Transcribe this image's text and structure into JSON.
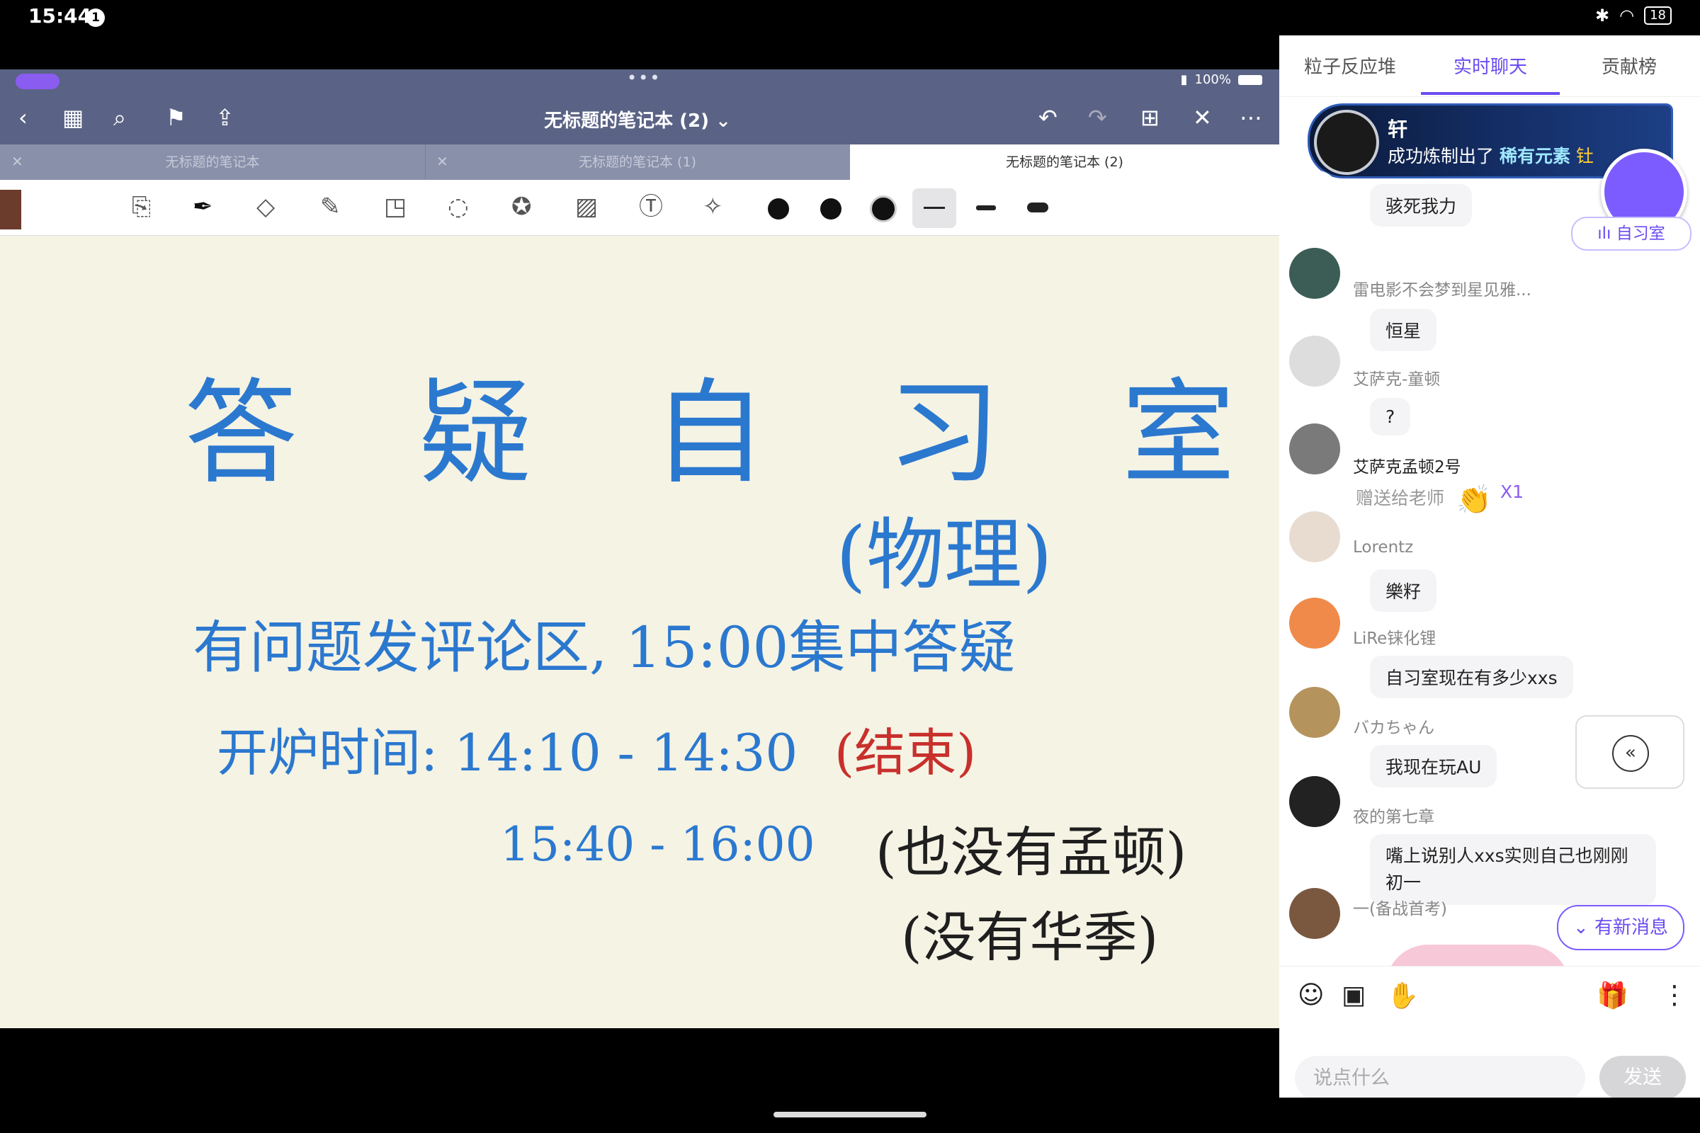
{
  "status": {
    "time": "15:44",
    "notif": "1",
    "battery": "18"
  },
  "notes_app": {
    "ipad_battery": "100%",
    "title": "无标题的笔记本 (2) ⌄",
    "tabs": [
      "无标题的笔记本",
      "无标题的笔记本 (1)",
      "无标题的笔记本 (2)"
    ],
    "handwriting": {
      "heading": "答 疑 自 习 室",
      "subheading": "(物理)",
      "line1": "有问题发评论区, 15:00集中答疑",
      "line2a": "开炉时间: 14:10 - 14:30",
      "line2b": "(结束)",
      "line3a": "15:40 - 16:00",
      "line3b": "(也没有孟顿)",
      "line4": "(没有华季)"
    },
    "colors": {
      "ink_blue": "#2b78cf",
      "ink_red": "#c8302c"
    }
  },
  "chat": {
    "tabs": [
      "粒子反应堆",
      "实时聊天",
      "贡献榜"
    ],
    "banner": {
      "name": "轩",
      "msg_prefix": "成功炼制出了",
      "msg_item": "稀有元素",
      "msg_tail": "钍"
    },
    "study_room_label": "ılı 自习室",
    "messages": [
      {
        "user": "",
        "text": "骇死我力"
      },
      {
        "user": "雷电影不会梦到星见雅...",
        "text": "恒星"
      },
      {
        "user": "艾萨克-童顿",
        "text": "?"
      },
      {
        "user": "艾萨克孟顿2号",
        "gift_text": "赠送给老师",
        "gift_count": "X1"
      },
      {
        "user": "Lorentz",
        "text": "樂籽"
      },
      {
        "user": "LiRe铼化锂",
        "text": "自习室现在有多少xxs"
      },
      {
        "user": "バカちゃん",
        "text": "我现在玩AU"
      },
      {
        "user": "夜的第七章",
        "text": "嘴上说别人xxs实则自己也刚刚初一"
      },
      {
        "user": "一(备战首考)",
        "text": ""
      }
    ],
    "new_messages": "⌄ 有新消息",
    "input_placeholder": "说点什么",
    "send": "发送",
    "accent": "#6b4cf0"
  }
}
